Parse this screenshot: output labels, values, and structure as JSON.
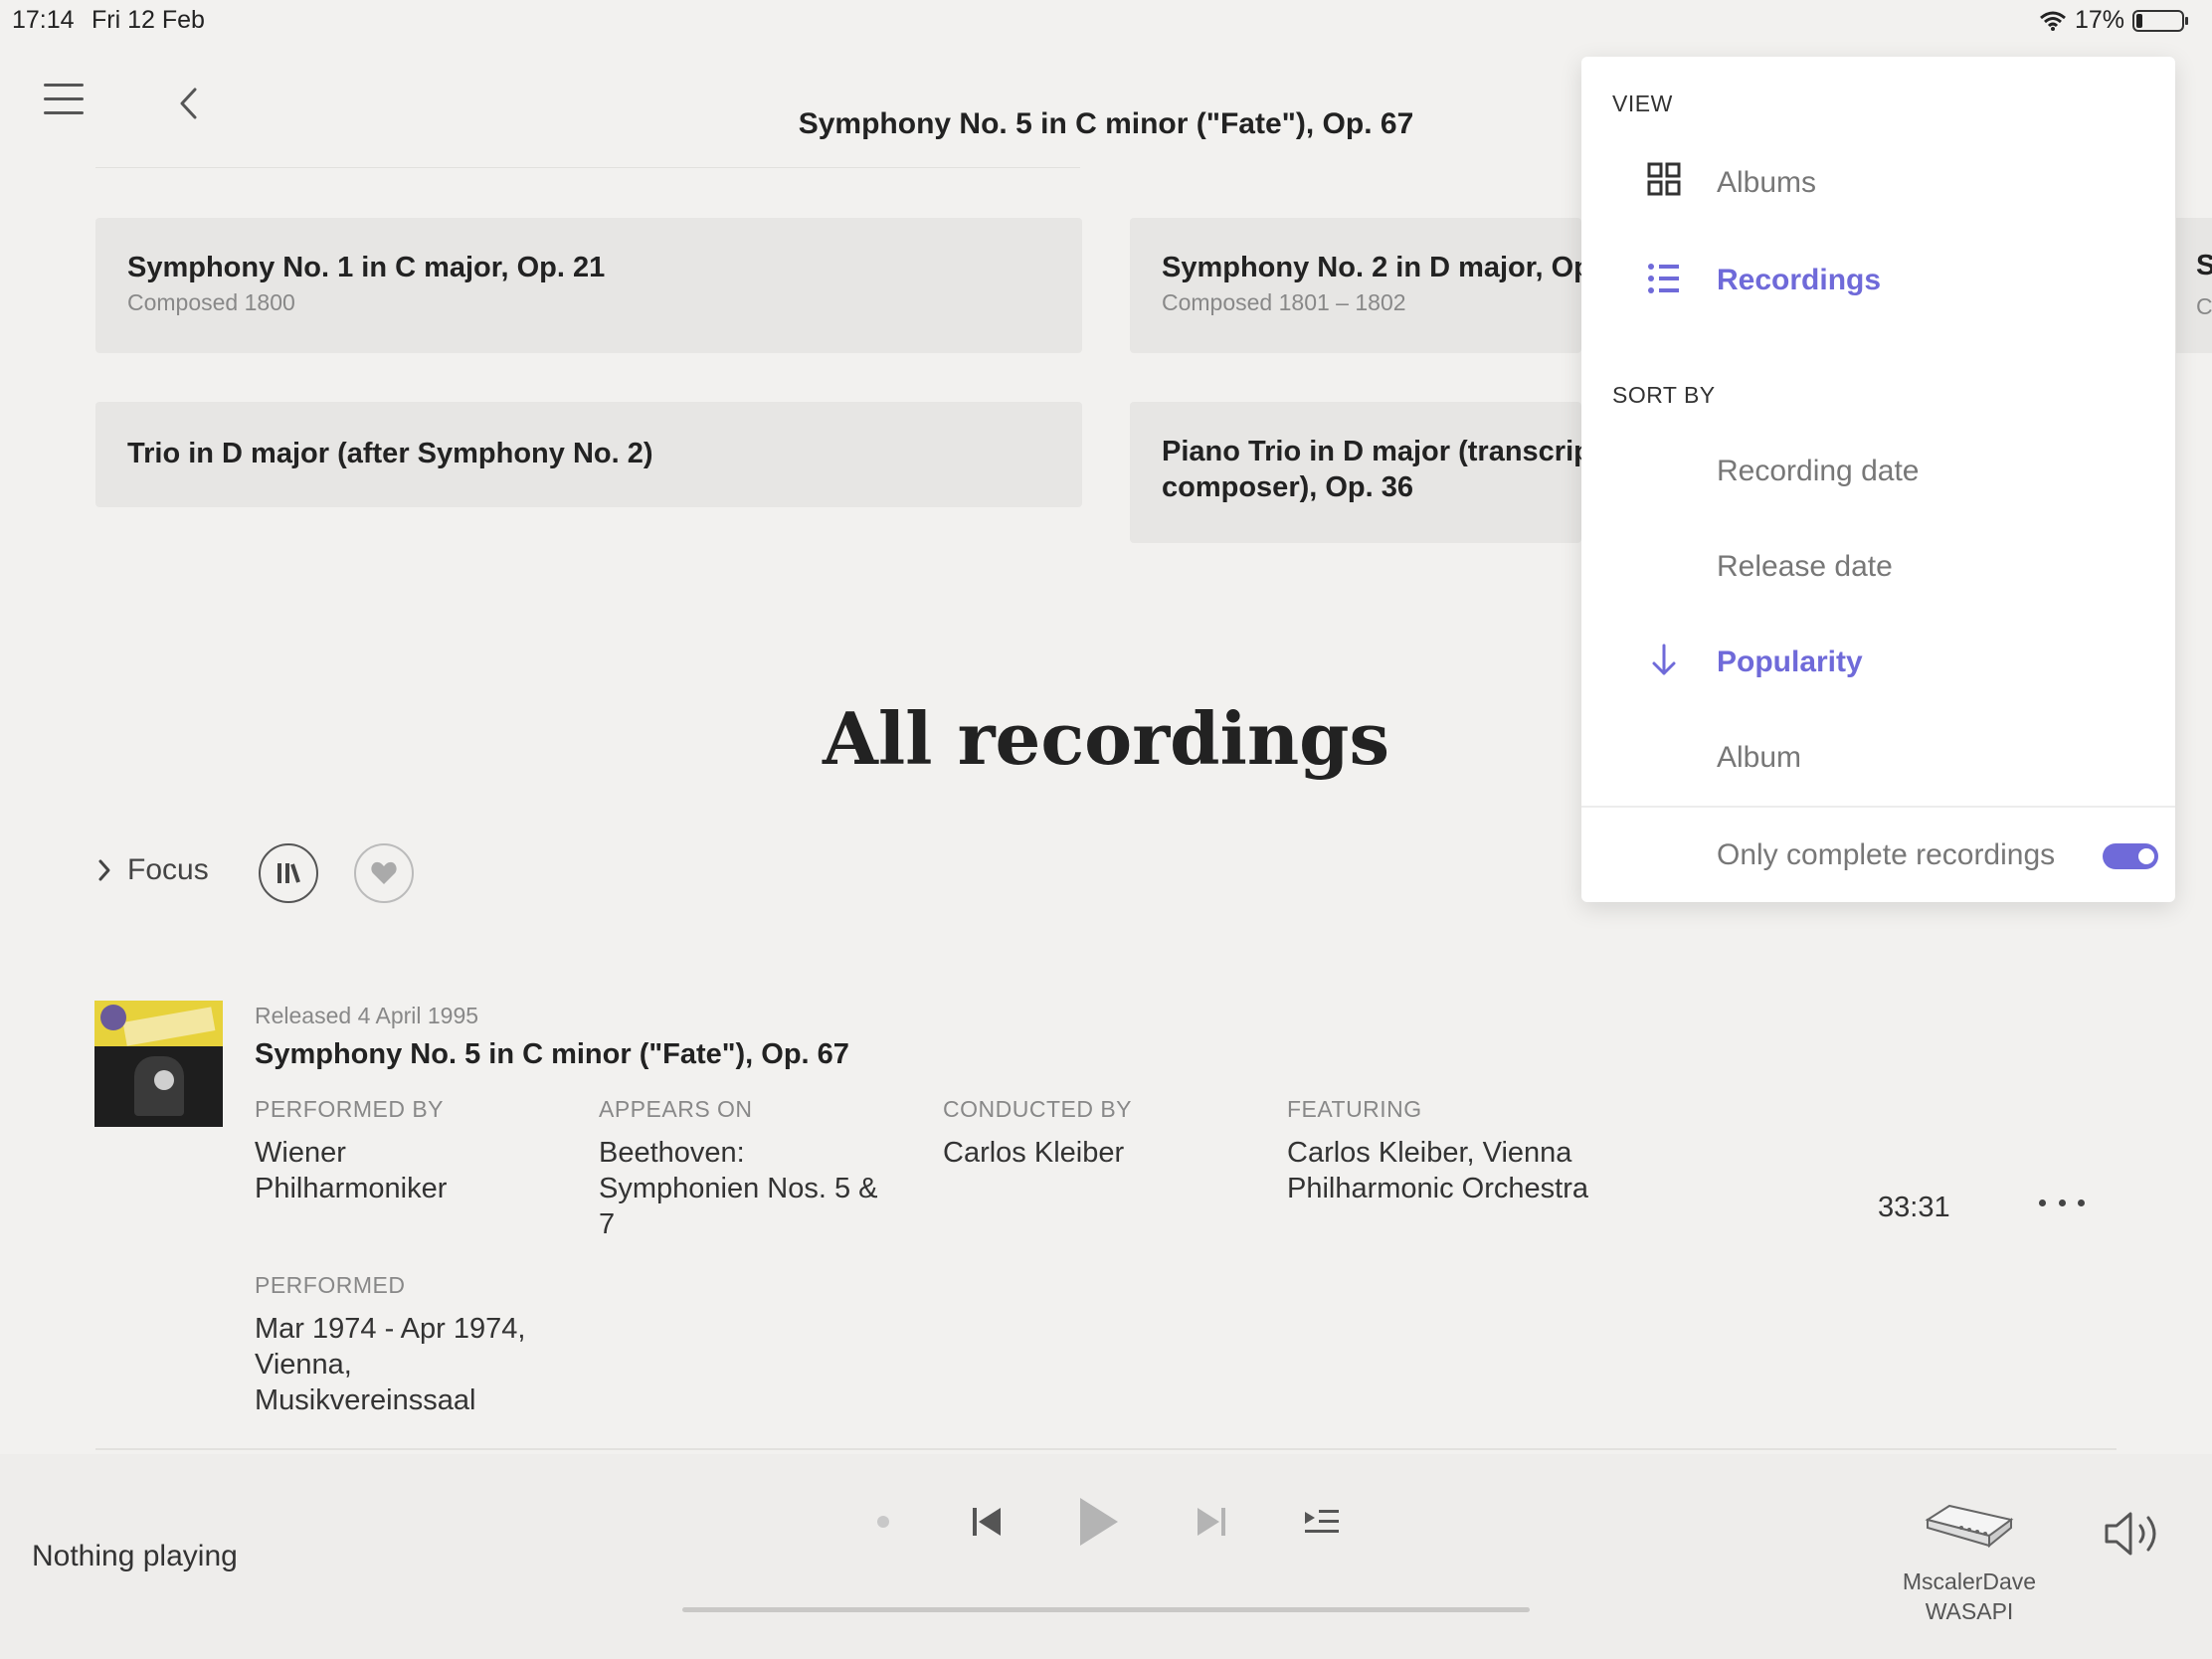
{
  "status_bar": {
    "time": "17:14",
    "date": "Fri 12 Feb",
    "battery": "17%"
  },
  "header": {
    "title": "Symphony No. 5 in C minor (\"Fate\"), Op. 67"
  },
  "works": [
    {
      "title": "Symphony No. 1 in C major, Op. 21",
      "subtitle": "Composed 1800"
    },
    {
      "title": "Symphony No. 2 in D major, Op.",
      "subtitle": "Composed 1801 – 1802"
    },
    {
      "title": "Trio in D major (after Symphony No. 2)",
      "subtitle": ""
    },
    {
      "title": "Piano Trio in D major (transcripti",
      "title_line2": "composer), Op. 36",
      "subtitle": ""
    },
    {
      "title": "S",
      "subtitle": "C"
    }
  ],
  "section_title": "All recordings",
  "focus": {
    "label": "Focus"
  },
  "recording": {
    "released": "Released 4 April 1995",
    "title": "Symphony No. 5 in C minor (\"Fate\"), Op. 67",
    "performed_by": {
      "heading": "PERFORMED BY",
      "value": "Wiener Philharmoniker"
    },
    "appears_on": {
      "heading": "APPEARS ON",
      "value": "Beethoven: Symphonien Nos. 5 & 7"
    },
    "conducted_by": {
      "heading": "CONDUCTED BY",
      "value": "Carlos Kleiber"
    },
    "featuring": {
      "heading": "FEATURING",
      "value": "Carlos Kleiber, Vienna Philharmonic Orchestra"
    },
    "performed": {
      "heading": "PERFORMED",
      "value": "Mar 1974 - Apr 1974, Vienna, Musikvereinssaal"
    },
    "duration": "33:31"
  },
  "player": {
    "status": "Nothing playing",
    "device_name": "MscalerDave",
    "device_output": "WASAPI",
    "progress": 0
  },
  "dropdown": {
    "view_heading": "VIEW",
    "view_options": [
      {
        "label": "Albums",
        "icon": "grid-icon",
        "active": false
      },
      {
        "label": "Recordings",
        "icon": "list-icon",
        "active": true
      }
    ],
    "sort_heading": "SORT BY",
    "sort_options": [
      {
        "label": "Recording date",
        "active": false
      },
      {
        "label": "Release date",
        "active": false
      },
      {
        "label": "Popularity",
        "active": true,
        "icon": "arrow-down-icon"
      },
      {
        "label": "Album",
        "active": false
      }
    ],
    "complete_toggle": {
      "label": "Only complete recordings",
      "on": true
    }
  },
  "colors": {
    "accent": "#6f6ad9",
    "background": "#f2f1ef",
    "card": "#e7e6e4"
  }
}
